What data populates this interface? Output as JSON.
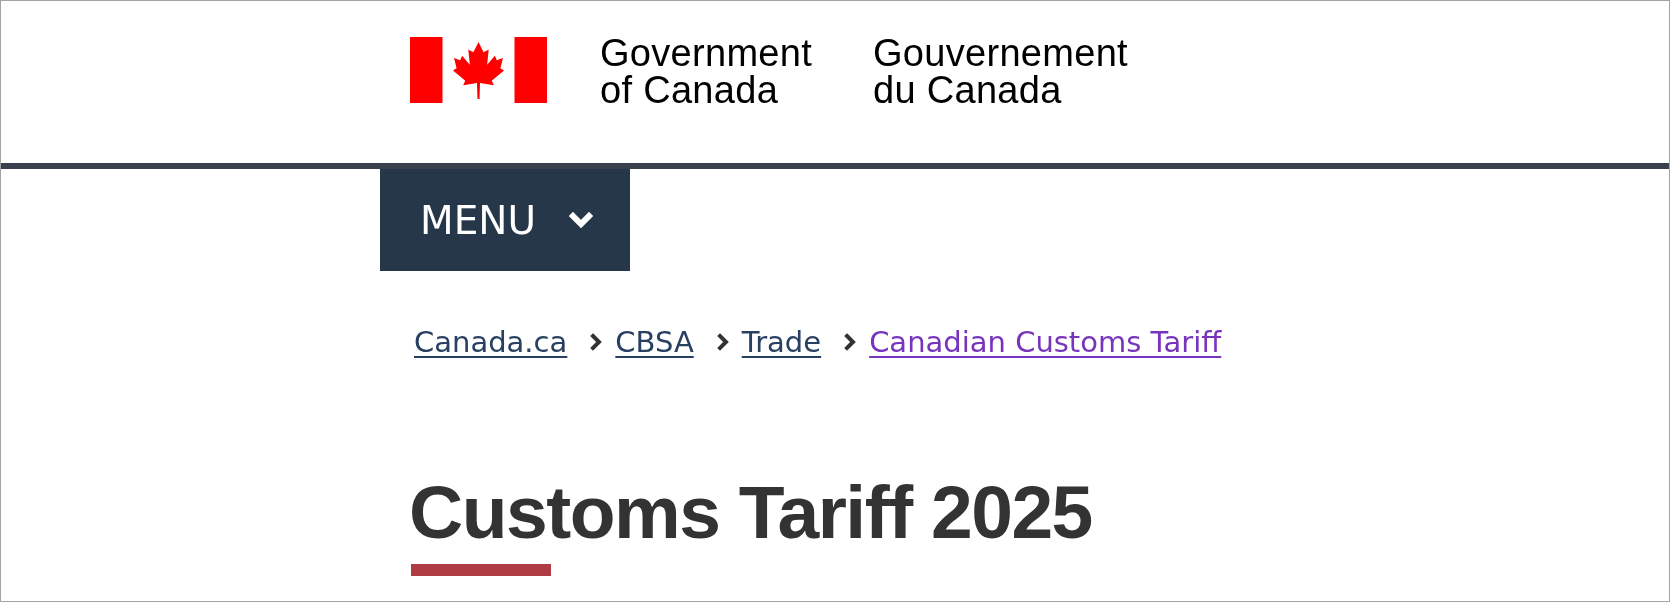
{
  "header": {
    "signature": [
      {
        "lines": [
          "Government",
          "of Canada"
        ]
      },
      {
        "lines": [
          "Gouvernement",
          "du Canada"
        ]
      }
    ]
  },
  "menu_button": {
    "label": "MENU",
    "expanded": false
  },
  "breadcrumbs": [
    {
      "label": "Canada.ca",
      "visited": false
    },
    {
      "label": "CBSA",
      "visited": false
    },
    {
      "label": "Trade",
      "visited": false
    },
    {
      "label": "Canadian Customs Tariff",
      "visited": true
    }
  ],
  "page_title": "Customs Tariff 2025"
}
